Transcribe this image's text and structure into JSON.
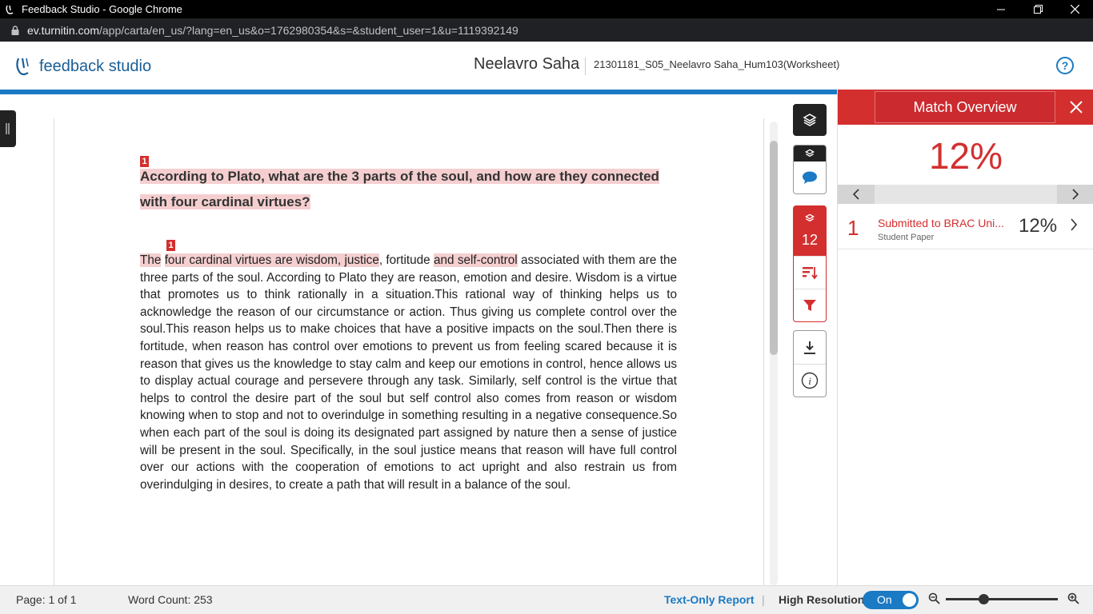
{
  "window": {
    "title": "Feedback Studio - Google Chrome"
  },
  "address": {
    "host": "ev.turnitin.com",
    "path": "/app/carta/en_us/?lang=en_us&o=1762980354&s=&student_user=1&u=1119392149"
  },
  "header": {
    "logo_text": "feedback studio",
    "student_name": "Neelavro Saha",
    "paper_title": "21301181_S05_Neelavro Saha_Hum103(Worksheet)",
    "help": "?"
  },
  "document": {
    "match_badge": "1",
    "heading_line1": "According to Plato, what are the 3 parts of the soul, and how are they connected",
    "heading_line2": "with four cardinal virtues?",
    "body_the": "The",
    "body_hl1": "four cardinal virtues are wisdom, justice",
    "body_mid": ", fortitude ",
    "body_hl2": "and self-control",
    "body_rest": " associated with them are the three parts of the soul. According to Plato they are reason, emotion and desire. Wisdom is a virtue that promotes us to think rationally in a situation.This rational way of thinking helps us to acknowledge the reason of our circumstance or action. Thus giving us complete control over the soul.This reason helps us to make choices that have a positive impacts on the soul.Then there is fortitude, when reason has control over emotions to prevent us from feeling scared because it is reason that gives us the knowledge to stay calm and keep our emotions in control, hence allows us to display actual courage and persevere through any task. Similarly, self control is the virtue that helps to control the desire part of the soul but self control also  comes from reason or wisdom knowing when to stop and not to  overindulge in something resulting in a negative consequence.So when each part of the soul is doing its designated part assigned by nature  then a sense of justice will be present in the soul. Specifically, in the soul justice means that reason will have full control over our actions with the cooperation of emotions to act upright and also restrain us from overindulging in desires, to create a path that will result in a balance of the soul."
  },
  "toolbar": {
    "similarity_count": "12"
  },
  "panel": {
    "title": "Match Overview",
    "overall_percent": "12%",
    "sources": [
      {
        "number": "1",
        "name": "Submitted to BRAC Uni...",
        "type": "Student Paper",
        "percent": "12%"
      }
    ]
  },
  "footer": {
    "page": "Page: 1 of 1",
    "word_count": "Word Count: 253",
    "text_only": "Text-Only Report",
    "sep": "|",
    "high_res_label": "High Resolution",
    "toggle": "On"
  },
  "colors": {
    "accent_red": "#d32f2f",
    "accent_blue": "#1a7ac4",
    "highlight": "#f5cfd0"
  }
}
